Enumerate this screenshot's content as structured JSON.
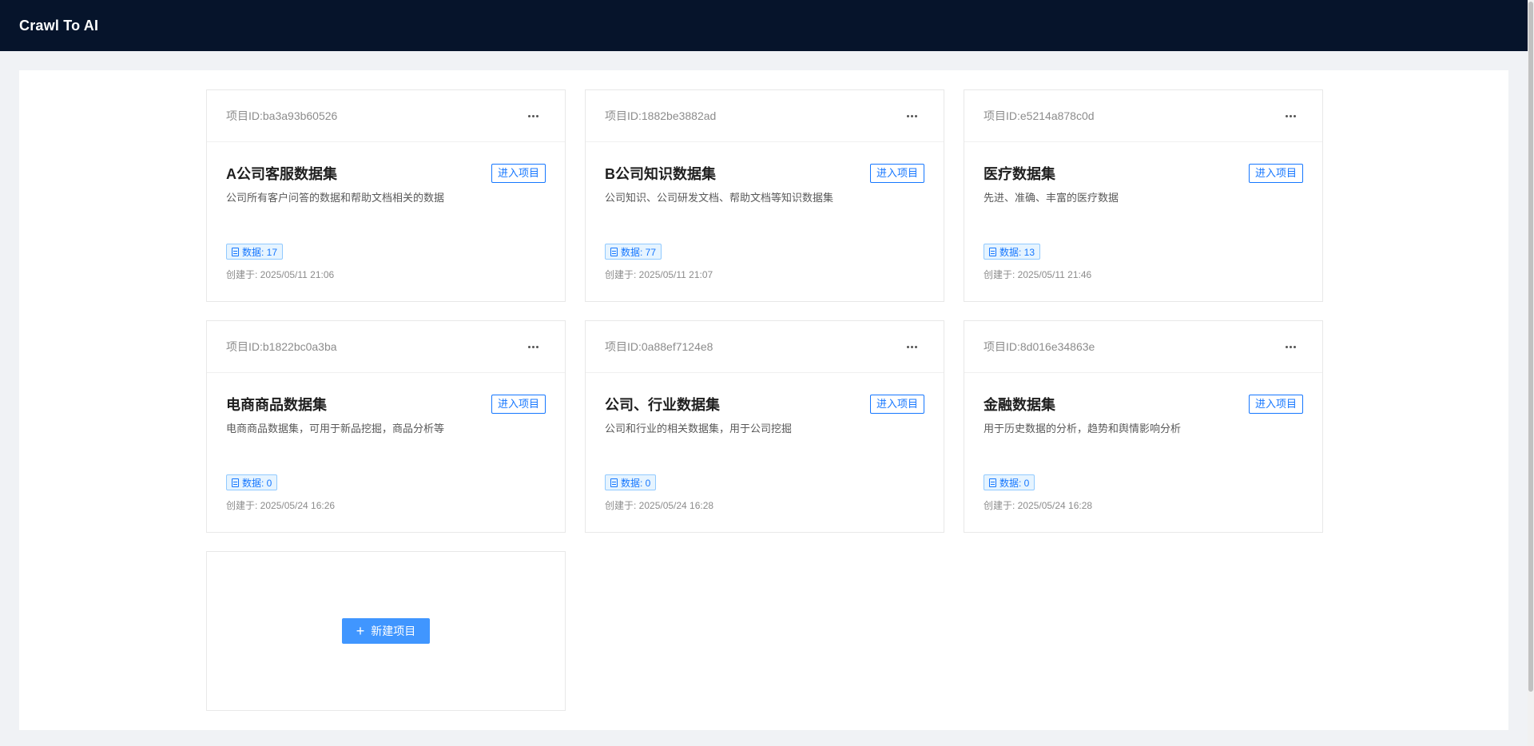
{
  "app": {
    "title": "Crawl To AI"
  },
  "projects": [
    {
      "id_label": "项目ID:ba3a93b60526",
      "name": "A公司客服数据集",
      "enter_label": "进入项目",
      "description": "公司所有客户问答的数据和帮助文档相关的数据",
      "data_label": "数据: 17",
      "created": "创建于: 2025/05/11 21:06"
    },
    {
      "id_label": "项目ID:1882be3882ad",
      "name": "B公司知识数据集",
      "enter_label": "进入项目",
      "description": "公司知识、公司研发文档、帮助文档等知识数据集",
      "data_label": "数据: 77",
      "created": "创建于: 2025/05/11 21:07"
    },
    {
      "id_label": "项目ID:e5214a878c0d",
      "name": "医疗数据集",
      "enter_label": "进入项目",
      "description": "先进、准确、丰富的医疗数据",
      "data_label": "数据: 13",
      "created": "创建于: 2025/05/11 21:46"
    },
    {
      "id_label": "项目ID:b1822bc0a3ba",
      "name": "电商商品数据集",
      "enter_label": "进入项目",
      "description": "电商商品数据集，可用于新品挖掘，商品分析等",
      "data_label": "数据: 0",
      "created": "创建于: 2025/05/24 16:26"
    },
    {
      "id_label": "项目ID:0a88ef7124e8",
      "name": "公司、行业数据集",
      "enter_label": "进入项目",
      "description": "公司和行业的相关数据集，用于公司挖掘",
      "data_label": "数据: 0",
      "created": "创建于: 2025/05/24 16:28"
    },
    {
      "id_label": "项目ID:8d016e34863e",
      "name": "金融数据集",
      "enter_label": "进入项目",
      "description": "用于历史数据的分析，趋势和舆情影响分析",
      "data_label": "数据: 0",
      "created": "创建于: 2025/05/24 16:28"
    }
  ],
  "new_project": {
    "label": "新建项目"
  },
  "colors": {
    "header_bg": "#06142b",
    "primary": "#1677ff",
    "new_button": "#4096ff"
  }
}
